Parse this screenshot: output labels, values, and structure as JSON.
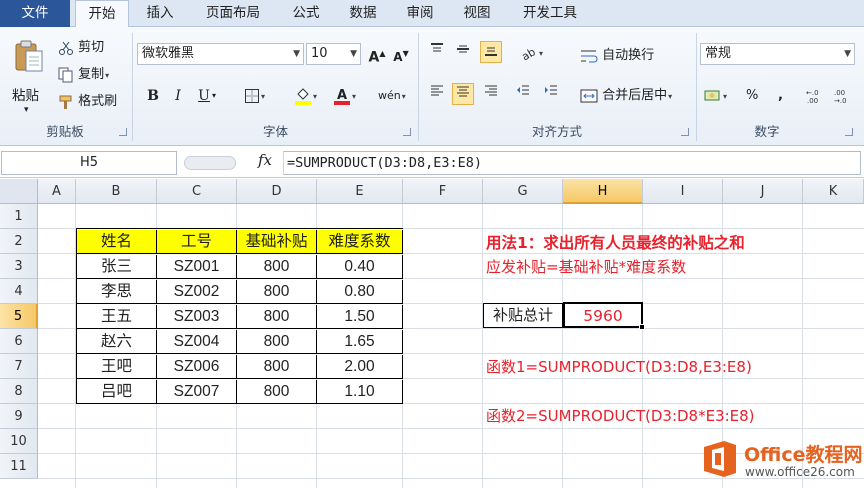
{
  "ribbon_tabs": [
    "文件",
    "开始",
    "插入",
    "页面布局",
    "公式",
    "数据",
    "审阅",
    "视图",
    "开发工具"
  ],
  "active_tab": "开始",
  "clipboard": {
    "paste": "粘贴",
    "cut": "剪切",
    "copy": "复制",
    "format_painter": "格式刷",
    "group": "剪贴板"
  },
  "font": {
    "name": "微软雅黑",
    "size": "10",
    "grow": "A",
    "shrink": "A",
    "bold": "B",
    "italic": "I",
    "underline": "U",
    "wen": "wén",
    "group": "字体"
  },
  "alignment": {
    "wrap": "自动换行",
    "merge": "合并后居中",
    "group": "对齐方式"
  },
  "number": {
    "format": "常规",
    "percent": "%",
    "comma": ",",
    "group": "数字"
  },
  "colors": {
    "accent": "#2b579a",
    "highlight": "#ffff00",
    "red": "#e8222c",
    "fill_yellow": "#ffff00"
  },
  "name_box": "H5",
  "fx_label": "fx",
  "formula": "=SUMPRODUCT(D3:D8,E3:E8)",
  "columns": [
    "A",
    "B",
    "C",
    "D",
    "E",
    "F",
    "G",
    "H",
    "I",
    "J",
    "K"
  ],
  "selected_column": "H",
  "rows": [
    "1",
    "2",
    "3",
    "4",
    "5",
    "6",
    "7",
    "8",
    "9",
    "10",
    "11"
  ],
  "selected_row": "5",
  "table": {
    "headers": [
      "姓名",
      "工号",
      "基础补贴",
      "难度系数"
    ],
    "rows": [
      [
        "张三",
        "SZ001",
        "800",
        "0.40"
      ],
      [
        "李思",
        "SZ002",
        "800",
        "0.80"
      ],
      [
        "王五",
        "SZ003",
        "800",
        "1.50"
      ],
      [
        "赵六",
        "SZ004",
        "800",
        "1.65"
      ],
      [
        "王吧",
        "SZ006",
        "800",
        "2.00"
      ],
      [
        "吕吧",
        "SZ007",
        "800",
        "1.10"
      ]
    ]
  },
  "notes": {
    "method_title": "用法1：求出所有人员最终的补贴之和",
    "method_desc": "应发补贴=基础补贴*难度系数",
    "total_label": "补贴总计",
    "total_value": "5960",
    "func1": "函数1=SUMPRODUCT(D3:D8,E3:E8)",
    "func2": "函数2=SUMPRODUCT(D3:D8*E3:E8)"
  },
  "watermark": {
    "title": "Office教程网",
    "url": "www.office26.com"
  }
}
